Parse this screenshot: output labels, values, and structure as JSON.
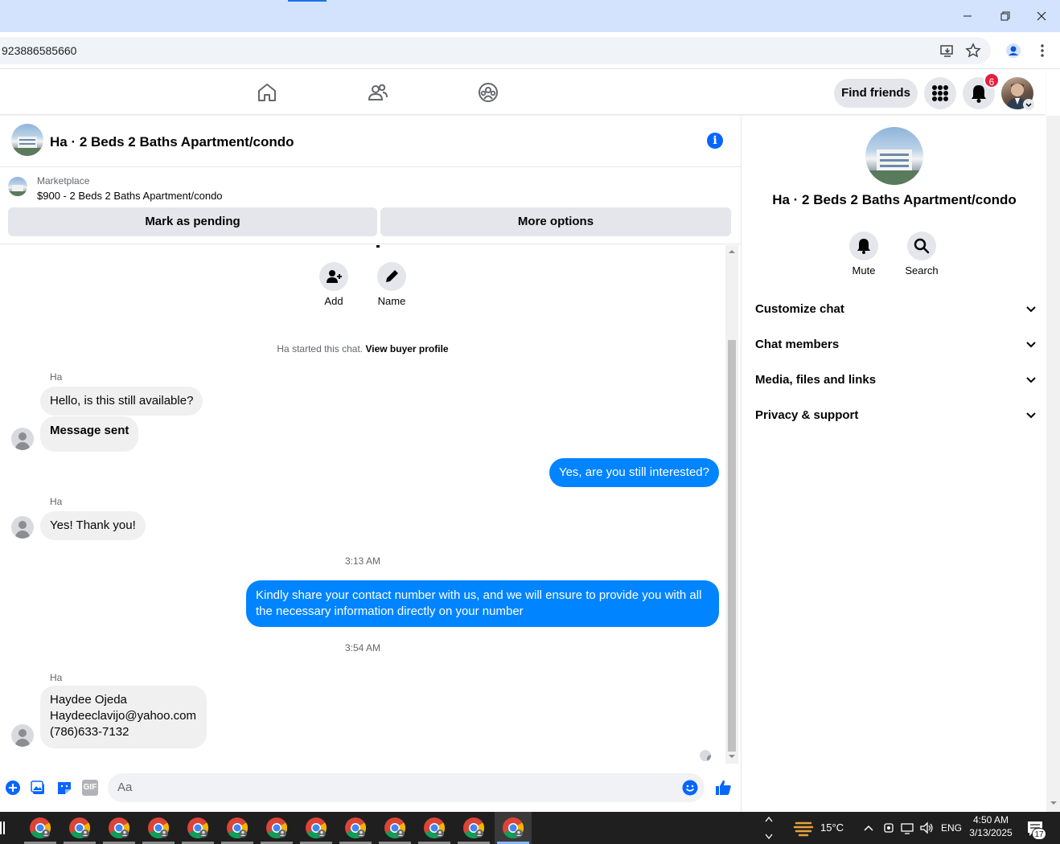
{
  "browser": {
    "url": "923886585660"
  },
  "nav": {
    "find_friends": "Find friends",
    "notification_count": "6"
  },
  "chat": {
    "title": "Ha · 2 Beds 2 Baths Apartment/condo",
    "marketplace_label": "Marketplace",
    "listing": "$900 - 2 Beds 2 Baths Apartment/condo",
    "mark_pending": "Mark as pending",
    "more_options": "More options",
    "actions": {
      "add": "Add",
      "name": "Name"
    },
    "started_text": "Ha started this chat. ",
    "view_buyer": "View buyer profile",
    "messages": [
      {
        "sender": "Ha",
        "text": "Hello, is this still available?"
      },
      {
        "text": "Message sent"
      },
      {
        "text": "Yes, are you still interested?"
      },
      {
        "sender": "Ha",
        "text": "Yes! Thank you!"
      },
      {
        "time": "3:13 AM"
      },
      {
        "text": "Kindly share your contact number with us, and we will ensure to provide you with all the necessary information directly on your number"
      },
      {
        "time": "3:54 AM"
      },
      {
        "sender": "Ha",
        "lines": [
          "Haydee Ojeda",
          "Haydeeclavijo@yahoo.com",
          "(786)633-7132"
        ]
      }
    ],
    "composer_placeholder": "Aa",
    "gif_label": "GIF"
  },
  "panel": {
    "title": "Ha · 2 Beds 2 Baths Apartment/condo",
    "mute": "Mute",
    "search": "Search",
    "items": [
      "Customize chat",
      "Chat members",
      "Media, files and links",
      "Privacy & support"
    ]
  },
  "taskbar": {
    "temperature": "15°C",
    "language": "ENG",
    "time": "4:50 AM",
    "date": "3/13/2025",
    "notification_count": "17"
  },
  "colors": {
    "accent": "#0866ff",
    "outgoing_bubble": "#0084ff",
    "incoming_bubble": "#f0f0f0"
  }
}
